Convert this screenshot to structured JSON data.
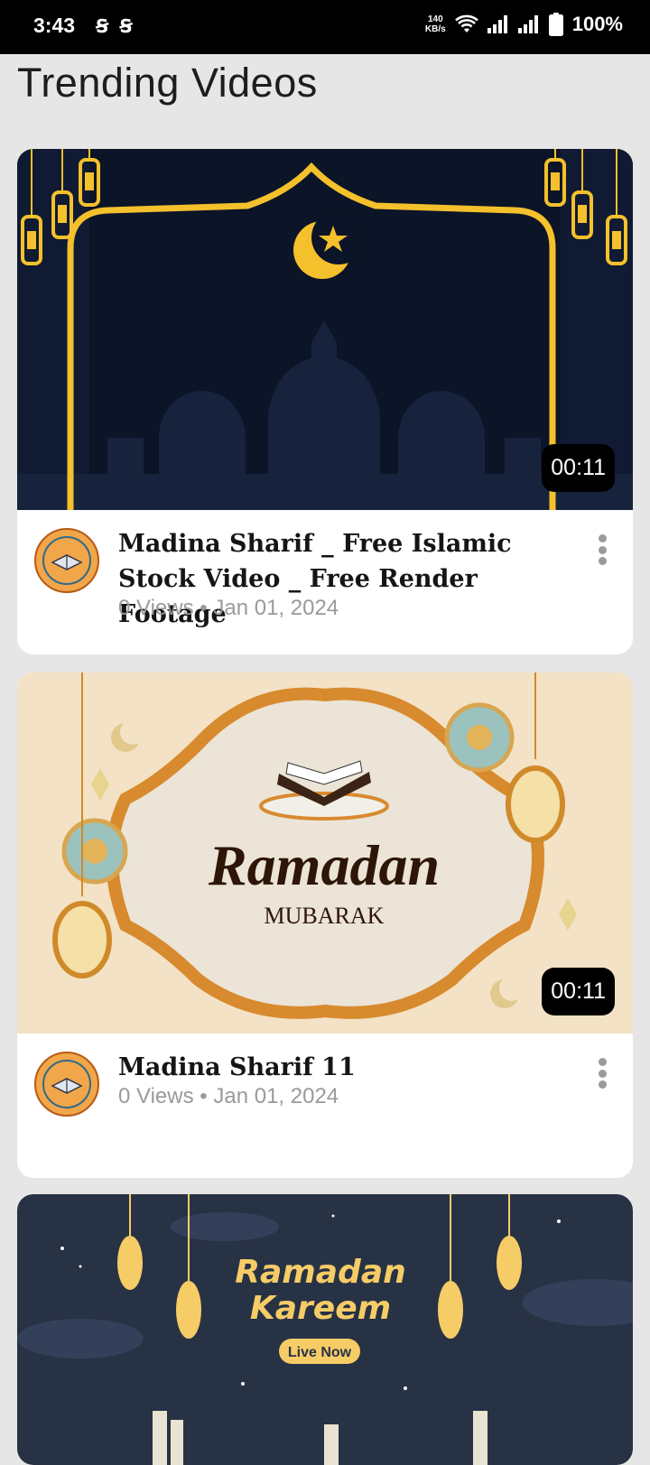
{
  "status_bar": {
    "time": "3:43",
    "speed_top": "140",
    "speed_bottom": "KB/s",
    "battery": "100%"
  },
  "page": {
    "title": "Trending Videos"
  },
  "videos": [
    {
      "title": "Madina Sharif _ Free Islamic Stock Video _ Free Render Footage",
      "views": "0 Views",
      "date": "Jan 01, 2024",
      "duration": "00:11"
    },
    {
      "title": "Madina Sharif 11",
      "views": "0 Views",
      "date": "Jan 01, 2024",
      "duration": "00:11",
      "thumbnail_text_1": "Ramadan",
      "thumbnail_text_2": "MUBARAK"
    },
    {
      "thumbnail_text_1": "Ramadan",
      "thumbnail_text_2": "Kareem",
      "thumbnail_badge": "Live Now"
    }
  ],
  "colors": {
    "background": "#e6e6e6",
    "card": "#ffffff",
    "gold": "#f4c02c",
    "navy": "#0f1a33"
  }
}
